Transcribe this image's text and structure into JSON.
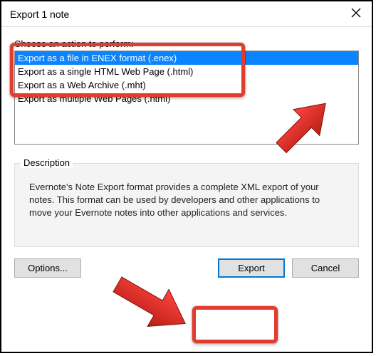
{
  "titlebar": {
    "title": "Export 1 note"
  },
  "choose_label": "Choose an action to perform:",
  "actions": [
    "Export as a file in ENEX format (.enex)",
    "Export as a single HTML Web Page (.html)",
    "Export as a Web Archive (.mht)",
    "Export as multiple Web Pages (.html)"
  ],
  "selected_index": 0,
  "description": {
    "label": "Description",
    "text": "Evernote's Note Export format provides a complete XML export of your notes. This format can be used by developers and other applications to move your Evernote notes into other applications and services."
  },
  "buttons": {
    "options": "Options...",
    "export": "Export",
    "cancel": "Cancel"
  }
}
